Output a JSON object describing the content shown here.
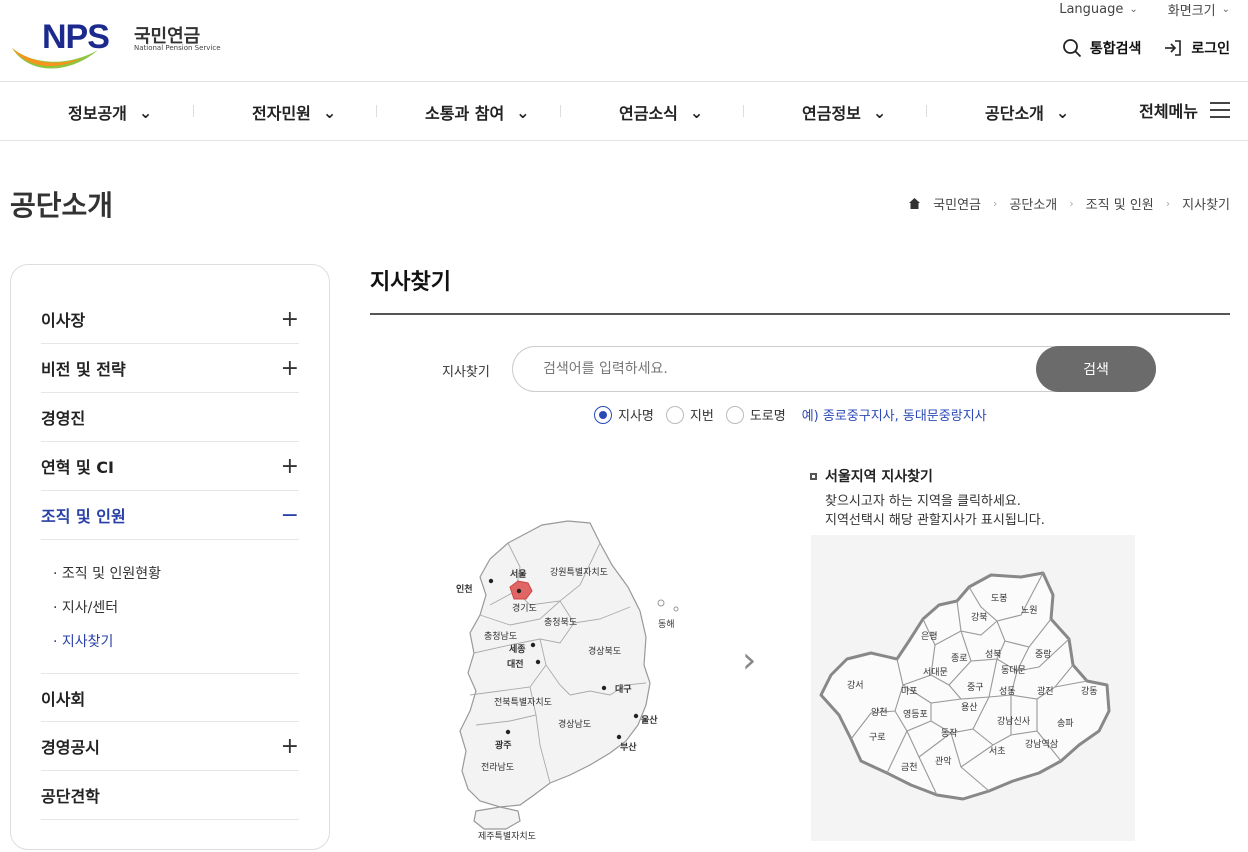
{
  "header": {
    "logo_mark": "NPS",
    "logo_kr": "국민연금",
    "logo_en": "National Pension Service",
    "language_label": "Language",
    "font_size_label": "화면크기",
    "search_label": "통합검색",
    "login_label": "로그인"
  },
  "gnb": {
    "items": [
      "정보공개",
      "전자민원",
      "소통과 참여",
      "연금소식",
      "연금정보",
      "공단소개"
    ],
    "all_menu": "전체메뉴"
  },
  "page": {
    "title": "공단소개",
    "breadcrumb": [
      "국민연금",
      "공단소개",
      "조직 및 인원",
      "지사찾기"
    ]
  },
  "lnb": {
    "items": [
      {
        "label": "이사장",
        "toggle": "+"
      },
      {
        "label": "비전 및 전략",
        "toggle": "+"
      },
      {
        "label": "경영진",
        "toggle": ""
      },
      {
        "label": "연혁 및 CI",
        "toggle": "+"
      },
      {
        "label": "조직 및 인원",
        "toggle": "−"
      },
      {
        "label": "이사회",
        "toggle": ""
      },
      {
        "label": "경영공시",
        "toggle": "+"
      },
      {
        "label": "공단견학",
        "toggle": ""
      }
    ],
    "sub_items": [
      "조직 및 인원현황",
      "지사/센터",
      "지사찾기"
    ]
  },
  "content": {
    "title": "지사찾기",
    "search": {
      "label": "지사찾기",
      "placeholder": "검색어를 입력하세요.",
      "button": "검색"
    },
    "radios": [
      "지사명",
      "지번",
      "도로명"
    ],
    "selected_radio": "지사명",
    "example": "예) 종로중구지사, 동대문중랑지사",
    "seoul_heading": "서울지역 지사찾기",
    "seoul_desc_1": "찾으시고자 하는 지역을 클릭하세요.",
    "seoul_desc_2": "지역선택시 해당 관할지사가 표시됩니다."
  },
  "korea_map": {
    "regions": [
      "서울",
      "인천",
      "경기도",
      "강원특별자치도",
      "충청북도",
      "충청남도",
      "세종",
      "대전",
      "경상북도",
      "대구",
      "전북특별자치도",
      "경상남도",
      "울산",
      "부산",
      "광주",
      "전라남도",
      "제주특별자치도",
      "동해"
    ],
    "highlighted": "서울"
  },
  "seoul_map": {
    "districts": [
      "도봉",
      "노원",
      "강북",
      "은평",
      "성북",
      "중랑",
      "종로",
      "동대문",
      "서대문",
      "강서",
      "마포",
      "중구",
      "성동",
      "광진",
      "강동",
      "양천",
      "영등포",
      "용산",
      "강남신사",
      "송파",
      "구로",
      "동작",
      "서초",
      "강남역삼",
      "금천",
      "관악"
    ]
  },
  "colors": {
    "brand_blue": "#1b2a8c",
    "active_blue": "#2940a8",
    "search_button": "#6b6b6b",
    "highlight_red": "#e06666"
  }
}
